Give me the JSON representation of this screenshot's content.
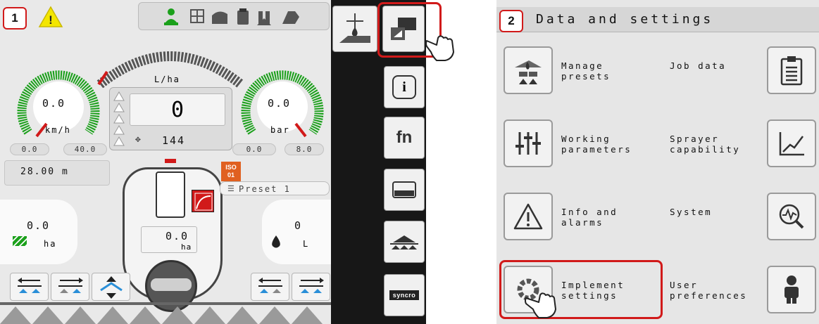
{
  "steps": {
    "first": "1",
    "second": "2"
  },
  "speed": {
    "value": "0.0",
    "unit": "km/h",
    "min": "0.0",
    "max": "40.0"
  },
  "application_rate": {
    "unit": "L/ha",
    "value": "0",
    "sub_value": "144"
  },
  "pressure": {
    "value": "0.0",
    "unit": "bar",
    "min": "0.0",
    "max": "8.0"
  },
  "boom_width": "28.00 m",
  "iso_badge": {
    "line1": "ISO",
    "line2": "01"
  },
  "preset": {
    "number": "1",
    "label": "Preset 1"
  },
  "area": {
    "value": "0.0",
    "unit": "ha"
  },
  "volume": {
    "value": "0",
    "unit": "L"
  },
  "tank_center": {
    "value": "0.0",
    "unit": "ha"
  },
  "side_menu": {
    "info_glyph": "i",
    "fn_label": "fn",
    "syncro_label": "syncro"
  },
  "data_settings": {
    "title": "Data and settings",
    "items": [
      {
        "id": "manage-presets",
        "lines": [
          "Manage",
          "presets"
        ]
      },
      {
        "id": "job-data",
        "lines": [
          "Job data"
        ]
      },
      {
        "id": "working-parameters",
        "lines": [
          "Working",
          "parameters"
        ]
      },
      {
        "id": "sprayer-capability",
        "lines": [
          "Sprayer",
          "capability"
        ]
      },
      {
        "id": "info-alarms",
        "lines": [
          "Info and",
          "alarms"
        ]
      },
      {
        "id": "system",
        "lines": [
          "System"
        ]
      },
      {
        "id": "implement-settings",
        "lines": [
          "Implement",
          "settings"
        ]
      },
      {
        "id": "user-preferences",
        "lines": [
          "User",
          "preferences"
        ]
      }
    ]
  },
  "colors": {
    "highlight": "#d11a1a",
    "gauge_green": "#1ba01b",
    "warning_yellow": "#f3e600",
    "accent_orange": "#e06020",
    "boom_blue": "#2a8fd8"
  }
}
